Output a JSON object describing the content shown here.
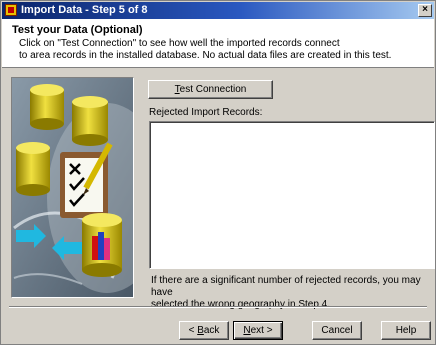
{
  "window": {
    "title": "Import Data - Step 5 of 8",
    "close_glyph": "×"
  },
  "header": {
    "title": "Test your Data (Optional)",
    "description_line1": "Click on \"Test Connection\" to see how well the imported records connect",
    "description_line2": "to area records in the installed database. No actual data files are created in this test."
  },
  "main": {
    "test_button_accel": "T",
    "test_button_rest": "est Connection",
    "rejected_label": "Rejected Import Records:",
    "rejected_records": "",
    "note_line1": "If there are a significant number of rejected records, you may have",
    "note_line2": "selected the wrong geography in Step 4."
  },
  "footer": {
    "back_prefix": "< ",
    "back_accel": "B",
    "back_rest": "ack",
    "next_accel": "N",
    "next_rest": "ext >",
    "cancel_label": "Cancel",
    "help_label": "Help"
  },
  "colors": {
    "title_bar": "#0a246a",
    "dialog_face": "#d4d0c8",
    "cylinder_yellow": "#d8c000",
    "arrow_cyan": "#20b8e0"
  }
}
